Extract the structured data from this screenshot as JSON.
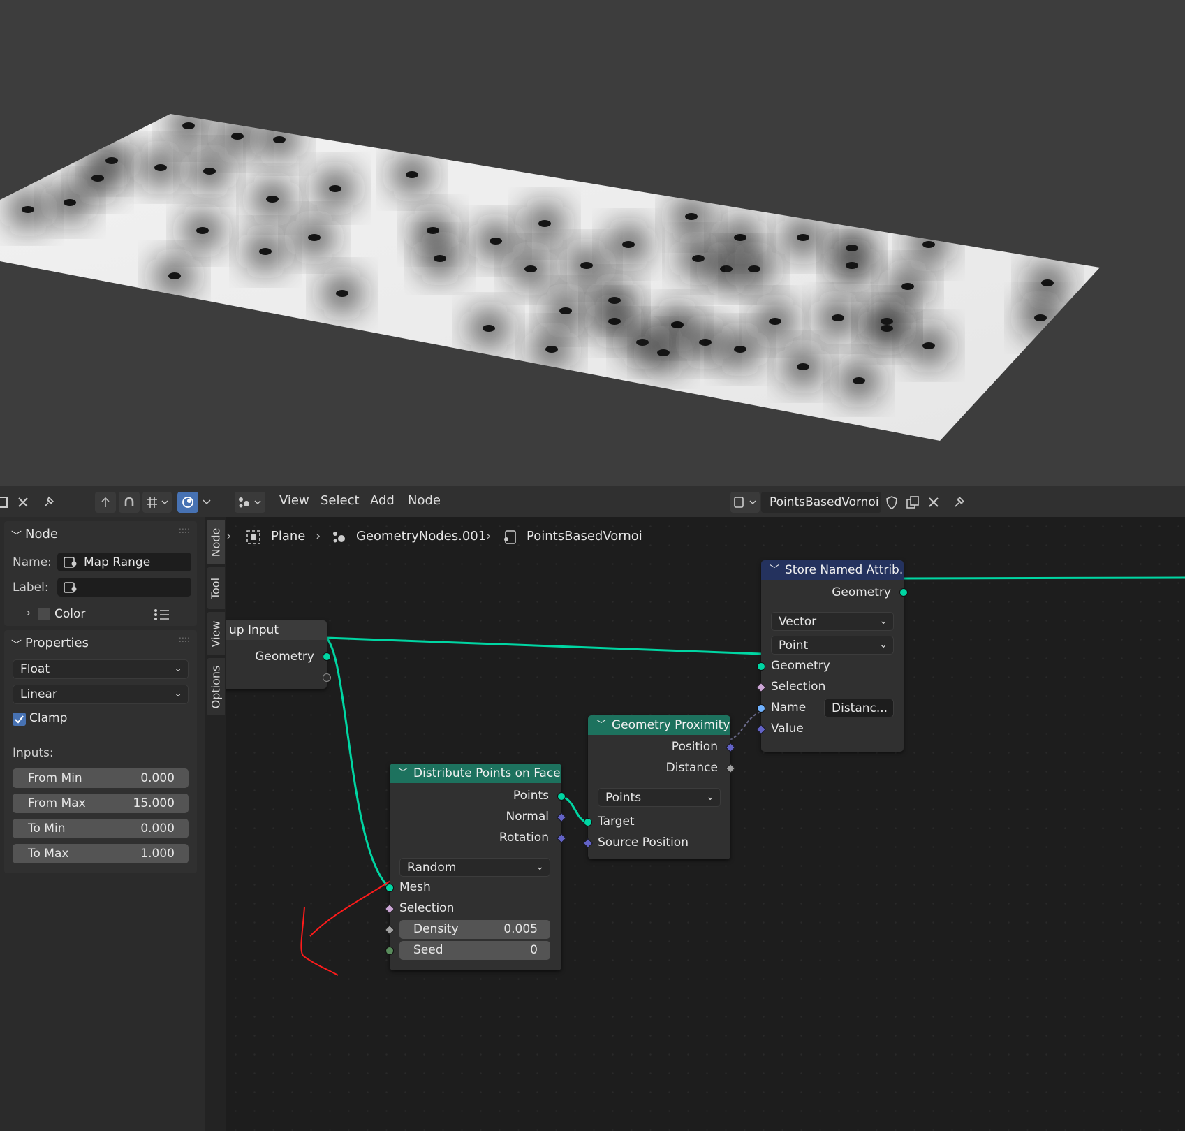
{
  "header": {
    "menu": [
      "View",
      "Select",
      "Add",
      "Node"
    ],
    "node_tree_name": "PointsBasedVornoi"
  },
  "breadcrumb": [
    "Plane",
    "GeometryNodes.001",
    "PointsBasedVornoi"
  ],
  "sidebar": {
    "tabs": [
      "Node",
      "Tool",
      "View",
      "Options"
    ],
    "node_panel": {
      "title": "Node",
      "name_label": "Name:",
      "name_value": "Map Range",
      "label_label": "Label:",
      "label_value": "",
      "color_label": "Color"
    },
    "properties_panel": {
      "title": "Properties",
      "data_type": "Float",
      "interpolation": "Linear",
      "clamp_label": "Clamp",
      "clamp_checked": true,
      "inputs_label": "Inputs:",
      "inputs": [
        {
          "label": "From Min",
          "value": "0.000"
        },
        {
          "label": "From Max",
          "value": "15.000"
        },
        {
          "label": "To Min",
          "value": "0.000"
        },
        {
          "label": "To Max",
          "value": "1.000"
        }
      ]
    }
  },
  "nodes": {
    "group_input": {
      "title": "up Input",
      "output": "Geometry"
    },
    "store_named_attribute": {
      "title": "Store Named Attrib...",
      "output": "Geometry",
      "data_type": "Vector",
      "domain": "Point",
      "inputs": [
        "Geometry",
        "Selection",
        "Name",
        "Value"
      ],
      "name_value": "Distanc..."
    },
    "geometry_proximity": {
      "title": "Geometry Proximity",
      "outputs": [
        "Position",
        "Distance"
      ],
      "mode": "Points",
      "inputs": [
        "Target",
        "Source Position"
      ]
    },
    "distribute_points": {
      "title": "Distribute Points on Faces",
      "outputs": [
        "Points",
        "Normal",
        "Rotation"
      ],
      "mode": "Random",
      "inputs": [
        "Mesh",
        "Selection"
      ],
      "density_label": "Density",
      "density_value": "0.005",
      "seed_label": "Seed",
      "seed_value": "0"
    }
  },
  "colors": {
    "geometry_socket": "#00d6a3",
    "vector_socket": "#6363c7",
    "bool_socket": "#cca6d6",
    "string_socket": "#70b2ff",
    "header_green": "#1d725e",
    "header_blue": "#24325e",
    "accent": "#4772b3",
    "annotation": "#ff1b1b"
  }
}
